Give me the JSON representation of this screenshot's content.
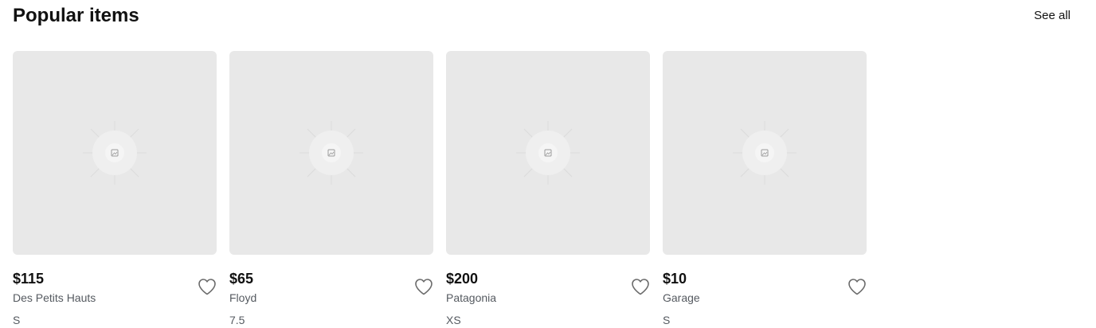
{
  "section": {
    "title": "Popular items",
    "see_all_label": "See all"
  },
  "items": [
    {
      "price": "$115",
      "brand": "Des Petits Hauts",
      "size": "S",
      "image_icon": "image-placeholder-icon",
      "favorite_icon": "heart-icon"
    },
    {
      "price": "$65",
      "brand": "Floyd",
      "size": "7.5",
      "image_icon": "image-placeholder-icon",
      "favorite_icon": "heart-icon"
    },
    {
      "price": "$200",
      "brand": "Patagonia",
      "size": "XS",
      "image_icon": "image-placeholder-icon",
      "favorite_icon": "heart-icon"
    },
    {
      "price": "$10",
      "brand": "Garage",
      "size": "S",
      "image_icon": "image-placeholder-icon",
      "favorite_icon": "heart-icon"
    }
  ],
  "colors": {
    "placeholder_bg": "#e8e8e8",
    "text_primary": "#111111",
    "text_secondary": "#555a60",
    "icon_stroke": "#6b6b6b"
  }
}
